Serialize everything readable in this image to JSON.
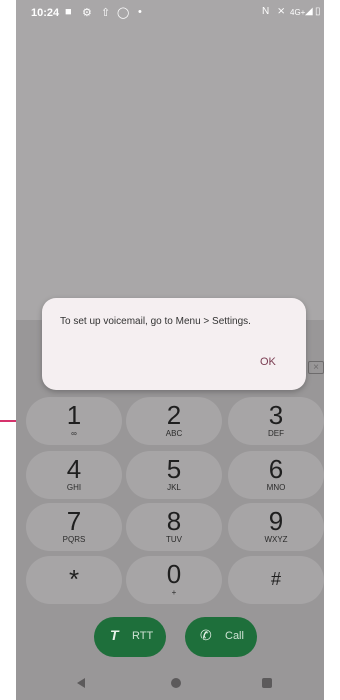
{
  "status_bar": {
    "time": "10:24",
    "left_icons": [
      "chat-icon",
      "settings-icon",
      "upload-icon",
      "timer-icon",
      "dot-icon"
    ],
    "right_icons": [
      "nfc-icon",
      "mute-icon",
      "4g-icon",
      "signal-icon",
      "battery-icon"
    ],
    "network_label": "4G+"
  },
  "dialog": {
    "message": "To set up voicemail, go to Menu > Settings.",
    "ok_label": "OK"
  },
  "keypad": {
    "keys": [
      {
        "digit": "1",
        "sub": "∞"
      },
      {
        "digit": "2",
        "sub": "ABC"
      },
      {
        "digit": "3",
        "sub": "DEF"
      },
      {
        "digit": "4",
        "sub": "GHI"
      },
      {
        "digit": "5",
        "sub": "JKL"
      },
      {
        "digit": "6",
        "sub": "MNO"
      },
      {
        "digit": "7",
        "sub": "PQRS"
      },
      {
        "digit": "8",
        "sub": "TUV"
      },
      {
        "digit": "9",
        "sub": "WXYZ"
      },
      {
        "digit": "*",
        "sub": ""
      },
      {
        "digit": "0",
        "sub": "+"
      },
      {
        "digit": "#",
        "sub": ""
      }
    ]
  },
  "actions": {
    "rtt_label": "RTT",
    "call_label": "Call"
  },
  "colors": {
    "call_green": "#1e6f3b",
    "dialog_bg": "#f5eff1",
    "ok_text": "#7a3d52",
    "callout_pink": "#d6336c"
  }
}
